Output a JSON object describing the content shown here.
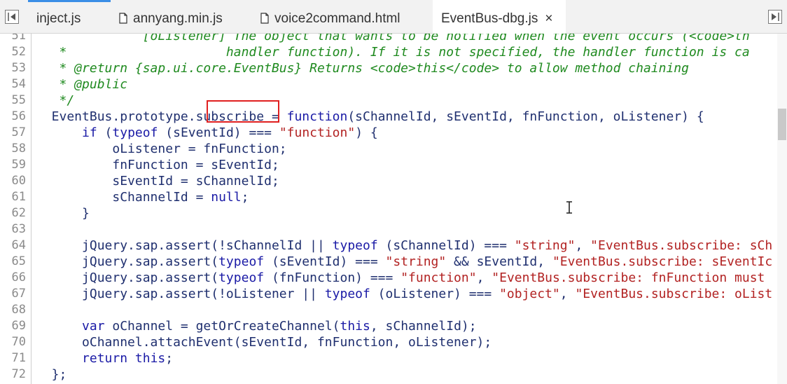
{
  "tabs": [
    {
      "label": "inject.js",
      "icon": "none",
      "active": false
    },
    {
      "label": "annyang.min.js",
      "icon": "file-icon",
      "active": false
    },
    {
      "label": "voice2command.html",
      "icon": "file-icon",
      "active": false
    },
    {
      "label": "EventBus-dbg.js",
      "icon": "none",
      "active": true,
      "close": "×"
    }
  ],
  "lines": [
    {
      "n": "51",
      "tokens": [
        [
          "com",
          "              [oListener] The object that wants to be notified when the event occurs (<code>th"
        ]
      ]
    },
    {
      "n": "52",
      "tokens": [
        [
          "com",
          "   *                     handler function). If it is not specified, the handler function is ca"
        ]
      ]
    },
    {
      "n": "53",
      "tokens": [
        [
          "com",
          "   * @return {sap.ui.core.EventBus} Returns <code>this</code> to allow method chaining"
        ]
      ]
    },
    {
      "n": "54",
      "tokens": [
        [
          "com",
          "   * @public"
        ]
      ]
    },
    {
      "n": "55",
      "tokens": [
        [
          "com",
          "   */"
        ]
      ]
    },
    {
      "n": "56",
      "tokens": [
        [
          "pl",
          "  EventBus.prototype.subscribe = "
        ],
        [
          "kw",
          "function"
        ],
        [
          "pl",
          "(sChannelId, sEventId, fnFunction, oListener) {"
        ]
      ]
    },
    {
      "n": "57",
      "tokens": [
        [
          "pl",
          "      "
        ],
        [
          "kw",
          "if"
        ],
        [
          "pl",
          " ("
        ],
        [
          "kw",
          "typeof"
        ],
        [
          "pl",
          " (sEventId) === "
        ],
        [
          "str",
          "\"function\""
        ],
        [
          "pl",
          ") {"
        ]
      ]
    },
    {
      "n": "58",
      "tokens": [
        [
          "pl",
          "          oListener = fnFunction;"
        ]
      ]
    },
    {
      "n": "59",
      "tokens": [
        [
          "pl",
          "          fnFunction = sEventId;"
        ]
      ]
    },
    {
      "n": "60",
      "tokens": [
        [
          "pl",
          "          sEventId = sChannelId;"
        ]
      ]
    },
    {
      "n": "61",
      "tokens": [
        [
          "pl",
          "          sChannelId = "
        ],
        [
          "kw",
          "null"
        ],
        [
          "pl",
          ";"
        ]
      ]
    },
    {
      "n": "62",
      "tokens": [
        [
          "pl",
          "      }"
        ]
      ]
    },
    {
      "n": "63",
      "tokens": []
    },
    {
      "n": "64",
      "tokens": [
        [
          "pl",
          "      jQuery.sap.assert(!sChannelId || "
        ],
        [
          "kw",
          "typeof"
        ],
        [
          "pl",
          " (sChannelId) === "
        ],
        [
          "str",
          "\"string\""
        ],
        [
          "pl",
          ", "
        ],
        [
          "str",
          "\"EventBus.subscribe: sCh"
        ]
      ]
    },
    {
      "n": "65",
      "tokens": [
        [
          "pl",
          "      jQuery.sap.assert("
        ],
        [
          "kw",
          "typeof"
        ],
        [
          "pl",
          " (sEventId) === "
        ],
        [
          "str",
          "\"string\""
        ],
        [
          "pl",
          " && sEventId, "
        ],
        [
          "str",
          "\"EventBus.subscribe: sEventIc"
        ]
      ]
    },
    {
      "n": "66",
      "tokens": [
        [
          "pl",
          "      jQuery.sap.assert("
        ],
        [
          "kw",
          "typeof"
        ],
        [
          "pl",
          " (fnFunction) === "
        ],
        [
          "str",
          "\"function\""
        ],
        [
          "pl",
          ", "
        ],
        [
          "str",
          "\"EventBus.subscribe: fnFunction must"
        ]
      ]
    },
    {
      "n": "67",
      "tokens": [
        [
          "pl",
          "      jQuery.sap.assert(!oListener || "
        ],
        [
          "kw",
          "typeof"
        ],
        [
          "pl",
          " (oListener) === "
        ],
        [
          "str",
          "\"object\""
        ],
        [
          "pl",
          ", "
        ],
        [
          "str",
          "\"EventBus.subscribe: oList"
        ]
      ]
    },
    {
      "n": "68",
      "tokens": []
    },
    {
      "n": "69",
      "tokens": [
        [
          "pl",
          "      "
        ],
        [
          "kw",
          "var"
        ],
        [
          "pl",
          " oChannel = getOrCreateChannel("
        ],
        [
          "kw",
          "this"
        ],
        [
          "pl",
          ", sChannelId);"
        ]
      ]
    },
    {
      "n": "70",
      "tokens": [
        [
          "pl",
          "      oChannel.attachEvent(sEventId, fnFunction, oListener);"
        ]
      ]
    },
    {
      "n": "71",
      "tokens": [
        [
          "pl",
          "      "
        ],
        [
          "kw",
          "return"
        ],
        [
          "pl",
          " "
        ],
        [
          "kw",
          "this"
        ],
        [
          "pl",
          ";"
        ]
      ]
    },
    {
      "n": "72",
      "tokens": [
        [
          "pl",
          "  };"
        ]
      ]
    }
  ],
  "colors": {
    "keyword": "#1a1aa6",
    "string": "#b22222",
    "comment": "#1f8a1f",
    "plain": "#1f2f6f",
    "highlight": "#e02020",
    "tab_accent": "#3a8ee6"
  }
}
